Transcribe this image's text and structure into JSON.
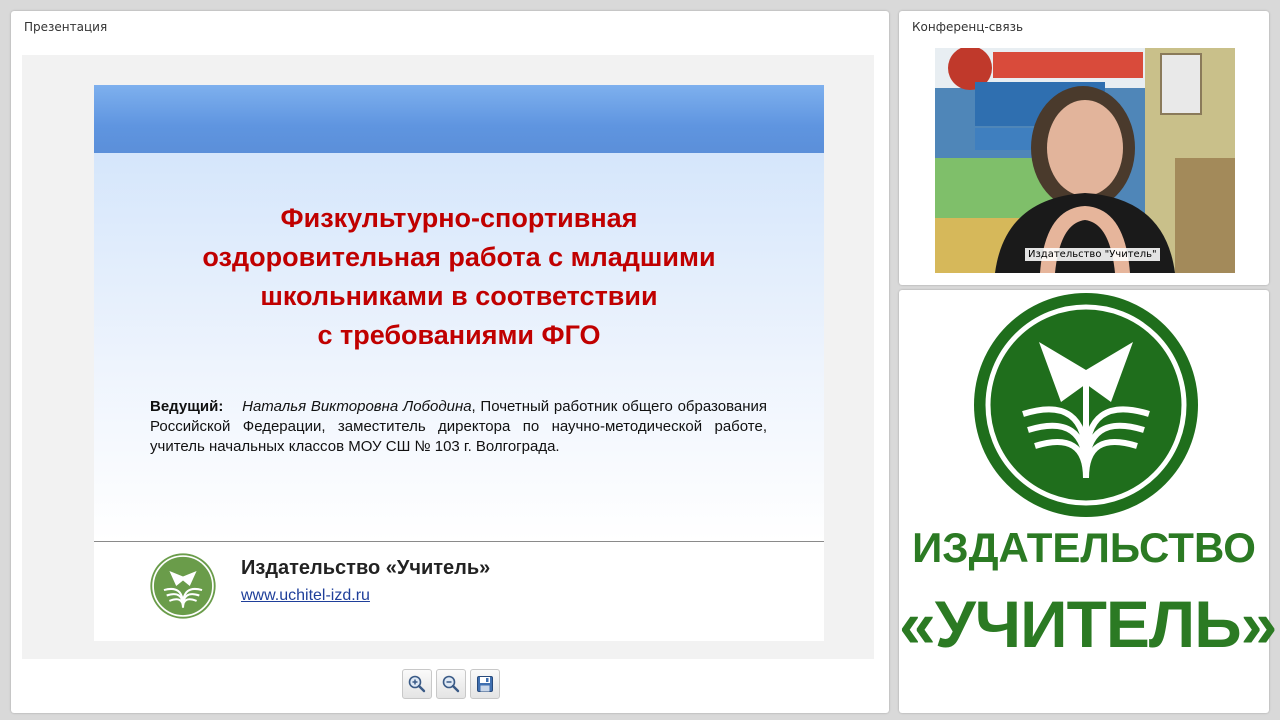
{
  "presentation_panel": {
    "title": "Презентация"
  },
  "slide": {
    "title_lines": [
      "Физкультурно-спортивная",
      "оздоровительная работа с младшими",
      "школьниками в соответствии",
      "с требованиями ФГО"
    ],
    "host_label": "Ведущий:",
    "host_name": "Наталья Викторовна Лободина",
    "host_description": ", Почетный работник общего образования Российской Федерации, заместитель директора по научно-методической работе, учитель начальных классов МОУ СШ № 103 г. Волгограда.",
    "publisher_name": "Издательство «Учитель»",
    "publisher_url": "www.uchitel-izd.ru"
  },
  "toolbar": {
    "zoom_in_icon": "zoom-in-icon",
    "zoom_out_icon": "zoom-out-icon",
    "save_icon": "save-icon"
  },
  "conference_panel": {
    "title": "Конференц-связь",
    "participant_label": "Издательство \"Учитель\""
  },
  "brand": {
    "line1": "ИЗДАТЕЛЬСТВО",
    "line2": "«УЧИТЕЛЬ»",
    "color": "#2b7a23"
  }
}
